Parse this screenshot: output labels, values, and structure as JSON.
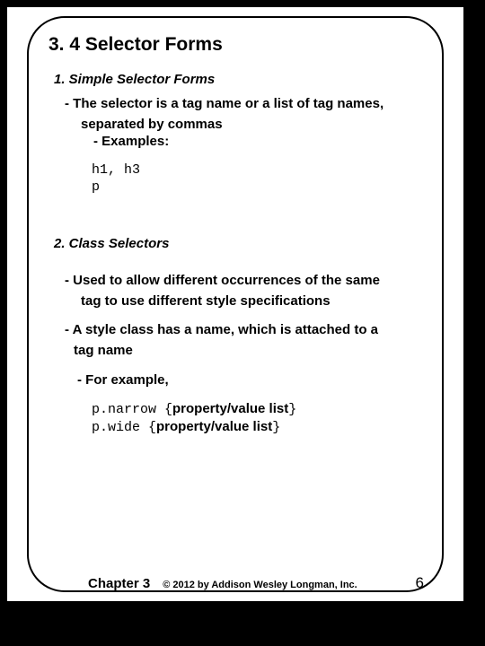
{
  "title": "3. 4 Selector Forms",
  "section1": {
    "heading": "1. Simple Selector Forms",
    "line1": "- The selector is a tag name or a list of tag names,",
    "line2": "separated by commas",
    "line3": "- Examples:",
    "code1": "h1, h3",
    "code2": "p"
  },
  "section2": {
    "heading": "2. Class Selectors",
    "line1": "- Used to allow different occurrences of the same",
    "line2": "tag to use different style specifications",
    "line3": "- A style class has a name, which is attached to a",
    "line4": "tag name",
    "forexample": "- For example,",
    "ex1_code": "p.narrow {",
    "ex1_prop": "property/value list",
    "ex1_close": "}",
    "ex2_code": "p.wide {",
    "ex2_prop": "property/value list",
    "ex2_close": "}"
  },
  "footer": {
    "chapter": "Chapter 3",
    "copyright": "© 2012 by Addison Wesley Longman, Inc.",
    "page": "6"
  }
}
